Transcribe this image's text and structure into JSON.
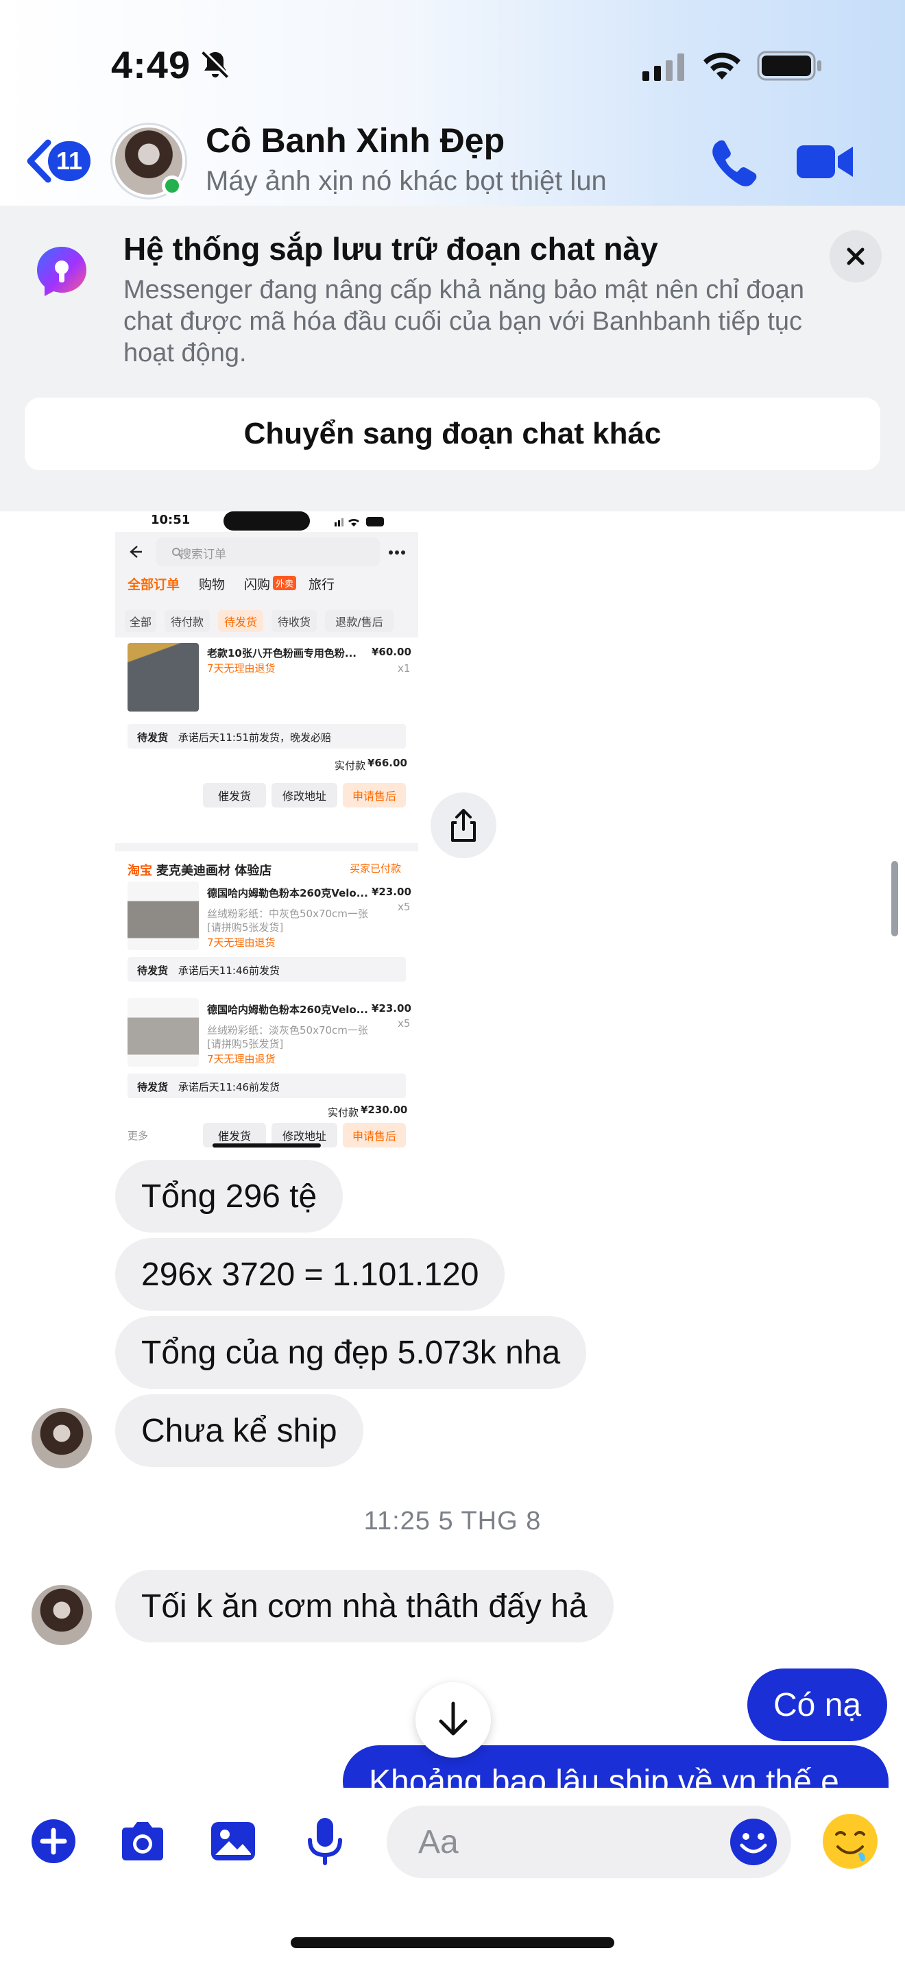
{
  "status_bar": {
    "time": "4:49"
  },
  "header": {
    "back_count": "11",
    "contact_name": "Cô Banh Xinh Đẹp",
    "contact_subtitle": "Máy ảnh xịn nó khác bọt thiệt lun"
  },
  "banner": {
    "title": "Hệ thống sắp lưu trữ đoạn chat này",
    "body": "Messenger đang nâng cấp khả năng bảo mật nên chỉ đoạn chat được mã hóa đầu cuối của bạn với Banhbanh tiếp tục hoạt động.",
    "button": "Chuyển sang đoạn chat khác"
  },
  "shared_image": {
    "status_time": "10:51",
    "search_placeholder": "搜索订单",
    "tabs": [
      "全部订单",
      "购物",
      "闪购",
      "旅行"
    ],
    "flash_badge": "外卖",
    "chips": [
      "全部",
      "待付款",
      "待发货",
      "待收货",
      "退款/售后"
    ],
    "order1": {
      "title": "老款10张八开色粉画专用色粉...",
      "price": "¥60.00",
      "qty": "x1",
      "return_note": "7天无理由退货",
      "ship_status": "待发货",
      "ship_note": "承诺后天11:51前发货，晚发必赔",
      "paid_label": "实付款",
      "paid": "¥66.00"
    },
    "actions": [
      "催发货",
      "修改地址",
      "申请售后"
    ],
    "store": "麦克美迪画材 体验店",
    "store_prefix": "淘宝",
    "store_status": "买家已付款",
    "order2": {
      "title": "德国哈内姆勒色粉本260克Velo...",
      "price": "¥23.00",
      "qty": "x5",
      "spec": "丝绒粉彩纸：中灰色50x70cm一张",
      "spec2": "[请拼购5张发货]",
      "return_note": "7天无理由退货",
      "ship_status": "待发货",
      "ship_note": "承诺后天11:46前发货"
    },
    "order3": {
      "title": "德国哈内姆勒色粉本260克Velo...",
      "price": "¥23.00",
      "qty": "x5",
      "spec": "丝绒粉彩纸：淡灰色50x70cm一张",
      "spec2": "[请拼购5张发货]",
      "return_note": "7天无理由退货",
      "ship_status": "待发货",
      "ship_note": "承诺后天11:46前发货"
    },
    "total_label": "实付款",
    "total": "¥230.00",
    "more": "更多"
  },
  "messages": [
    {
      "text": "Tổng 296 tệ",
      "direction": "incoming"
    },
    {
      "text": "296x 3720 = 1.101.120",
      "direction": "incoming"
    },
    {
      "text": "Tổng của ng đẹp 5.073k nha",
      "direction": "incoming"
    },
    {
      "text": "Chưa kể ship",
      "direction": "incoming"
    },
    {
      "text": "Tối k ăn cơm nhà thâth đấy hả",
      "direction": "incoming"
    },
    {
      "text": "Có nạ",
      "direction": "outgoing"
    },
    {
      "text": "Khoảng bao lâu ship về vn thế e",
      "direction": "outgoing"
    }
  ],
  "timestamp": "11:25 5 THG 8",
  "composer": {
    "placeholder": "Aa",
    "icons": [
      "plus-icon",
      "camera-icon",
      "gallery-icon",
      "microphone-icon",
      "emoji-icon",
      "sticker-icon"
    ]
  },
  "colors": {
    "accent": "#1a2fd6",
    "incoming_bubble": "#efeff1",
    "online": "#22b14c"
  }
}
